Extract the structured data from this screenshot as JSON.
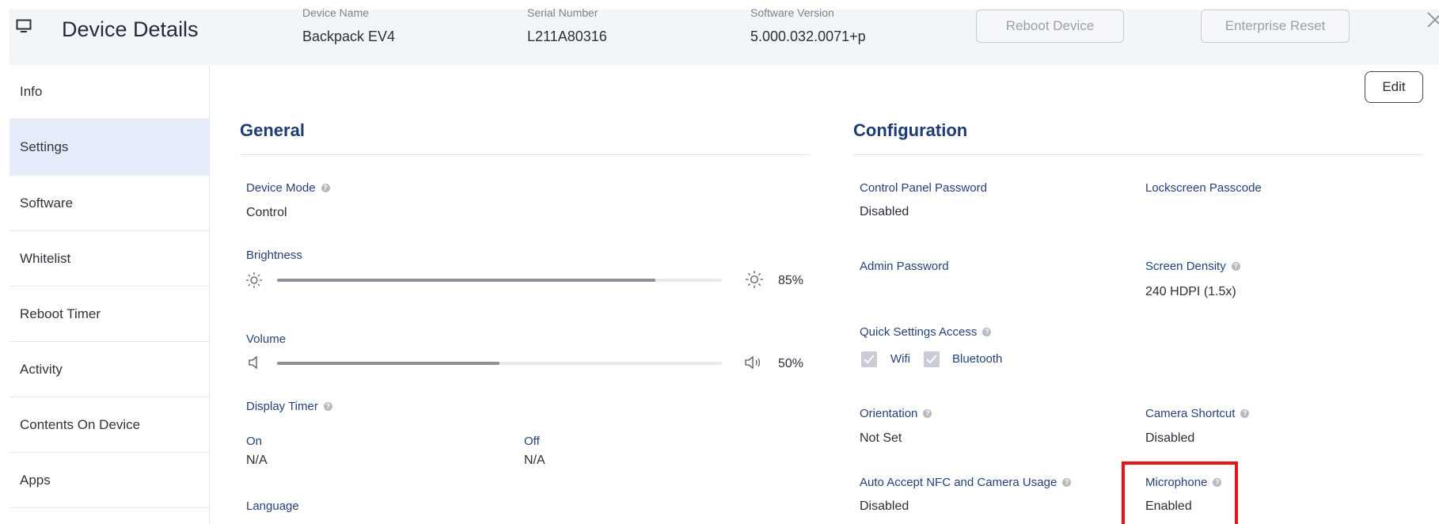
{
  "header": {
    "title": "Device Details",
    "device_name_label": "Device Name",
    "device_name": "Backpack EV4",
    "serial_label": "Serial Number",
    "serial": "L211A80316",
    "software_label": "Software Version",
    "software": "5.000.032.0071+p",
    "reboot_button": "Reboot Device",
    "reset_button": "Enterprise Reset"
  },
  "sidebar": {
    "items": [
      {
        "label": "Info"
      },
      {
        "label": "Settings"
      },
      {
        "label": "Software"
      },
      {
        "label": "Whitelist"
      },
      {
        "label": "Reboot Timer"
      },
      {
        "label": "Activity"
      },
      {
        "label": "Contents On Device"
      },
      {
        "label": "Apps"
      }
    ],
    "active": "Settings"
  },
  "main": {
    "edit_button": "Edit",
    "general": {
      "title": "General",
      "device_mode_label": "Device Mode",
      "device_mode": "Control",
      "brightness_label": "Brightness",
      "brightness_value": "85%",
      "volume_label": "Volume",
      "volume_value": "50%",
      "display_timer_label": "Display Timer",
      "on_label": "On",
      "on_value": "N/A",
      "off_label": "Off",
      "off_value": "N/A",
      "language_label": "Language"
    },
    "configuration": {
      "title": "Configuration",
      "control_panel_password_label": "Control Panel Password",
      "control_panel_password": "Disabled",
      "lockscreen_passcode_label": "Lockscreen Passcode",
      "admin_password_label": "Admin Password",
      "screen_density_label": "Screen Density",
      "screen_density": "240 HDPI (1.5x)",
      "quick_settings_label": "Quick Settings Access",
      "wifi_label": "Wifi",
      "bluetooth_label": "Bluetooth",
      "orientation_label": "Orientation",
      "orientation": "Not Set",
      "camera_shortcut_label": "Camera Shortcut",
      "camera_shortcut": "Disabled",
      "auto_accept_label": "Auto Accept NFC and Camera Usage",
      "auto_accept": "Disabled",
      "microphone_label": "Microphone",
      "microphone": "Enabled"
    }
  },
  "colors": {
    "header_bg": "#f3f6f9",
    "active_nav_bg": "#e7ecfb",
    "section_title": "#1f3b73",
    "field_label": "#27427a",
    "highlight": "#e8141c"
  },
  "icons": [
    "monitor-icon",
    "close-icon",
    "sun-icon",
    "speaker-icon",
    "help-icon",
    "checkmark-icon"
  ]
}
